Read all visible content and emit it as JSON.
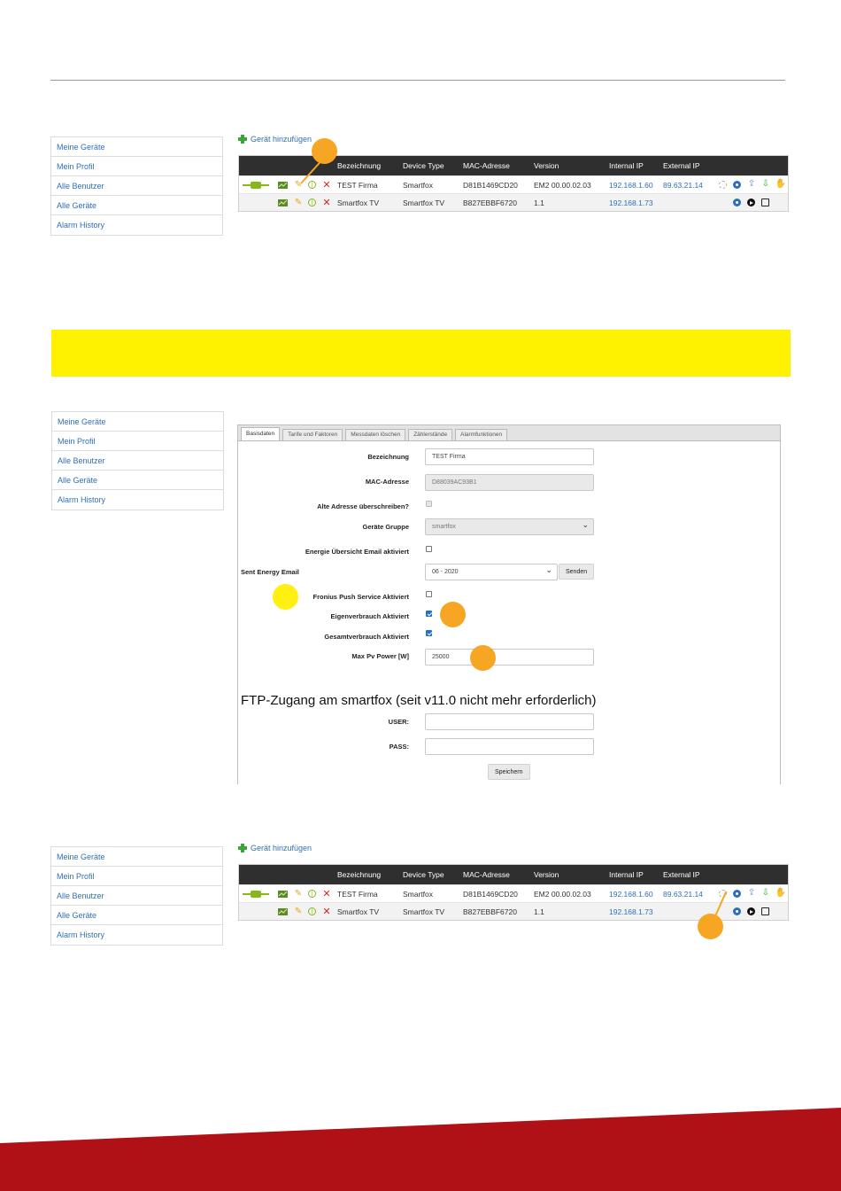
{
  "sidebar": {
    "items": [
      "Meine Geräte",
      "Mein Profil",
      "Alle Benutzer",
      "Alle Geräte",
      "Alarm History"
    ]
  },
  "add_device_label": "Gerät hinzufügen",
  "device_table": {
    "columns": [
      "Bezeichnung",
      "Device Type",
      "MAC-Adresse",
      "Version",
      "Internal IP",
      "External IP"
    ],
    "rows": [
      {
        "name": "TEST Firma",
        "type": "Smartfox",
        "mac": "D81B1469CD20",
        "version": "EM2 00.00.02.03",
        "internal_ip": "192.168.1.60",
        "external_ip": "89.63.21.14"
      },
      {
        "name": "Smartfox TV",
        "type": "Smartfox TV",
        "mac": "B827EBBF6720",
        "version": "1.1",
        "internal_ip": "192.168.1.73",
        "external_ip": ""
      }
    ]
  },
  "form": {
    "tabs": [
      "Basisdaten",
      "Tarife und Faktoren",
      "Messdaten löschen",
      "Zählerstände",
      "Alarmfunktionen"
    ],
    "active_tab": "Basisdaten",
    "bezeichnung": {
      "label": "Bezeichnung",
      "value": "TEST Firma"
    },
    "mac": {
      "label": "MAC-Adresse",
      "value": "D88039AC93B1"
    },
    "overwrite_label": "Alte Adresse überschreiben?",
    "group": {
      "label": "Geräte Gruppe",
      "value": "smartfox"
    },
    "energy_email_label": "Energie Übersicht Email aktiviert",
    "sent_email": {
      "label": "Sent Energy Email",
      "value": "06 - 2020",
      "button": "Senden"
    },
    "fronius_label": "Fronius Push Service Aktiviert",
    "eigen_label": "Eigenverbrauch Aktiviert",
    "gesamt_label": "Gesamtverbrauch Aktiviert",
    "maxpv": {
      "label": "Max Pv Power [W]",
      "value": "25000"
    },
    "ftp_title": "FTP-Zugang am smartfox (seit v11.0 nicht mehr erforderlich)",
    "user_label": "USER:",
    "pass_label": "PASS:",
    "save_button": "Speichern"
  },
  "colors": {
    "callout_orange": "#f6a623",
    "callout_yellow": "#fff012",
    "banner": "#fff200",
    "footer": "#b01116",
    "link": "#2f6fb7"
  }
}
